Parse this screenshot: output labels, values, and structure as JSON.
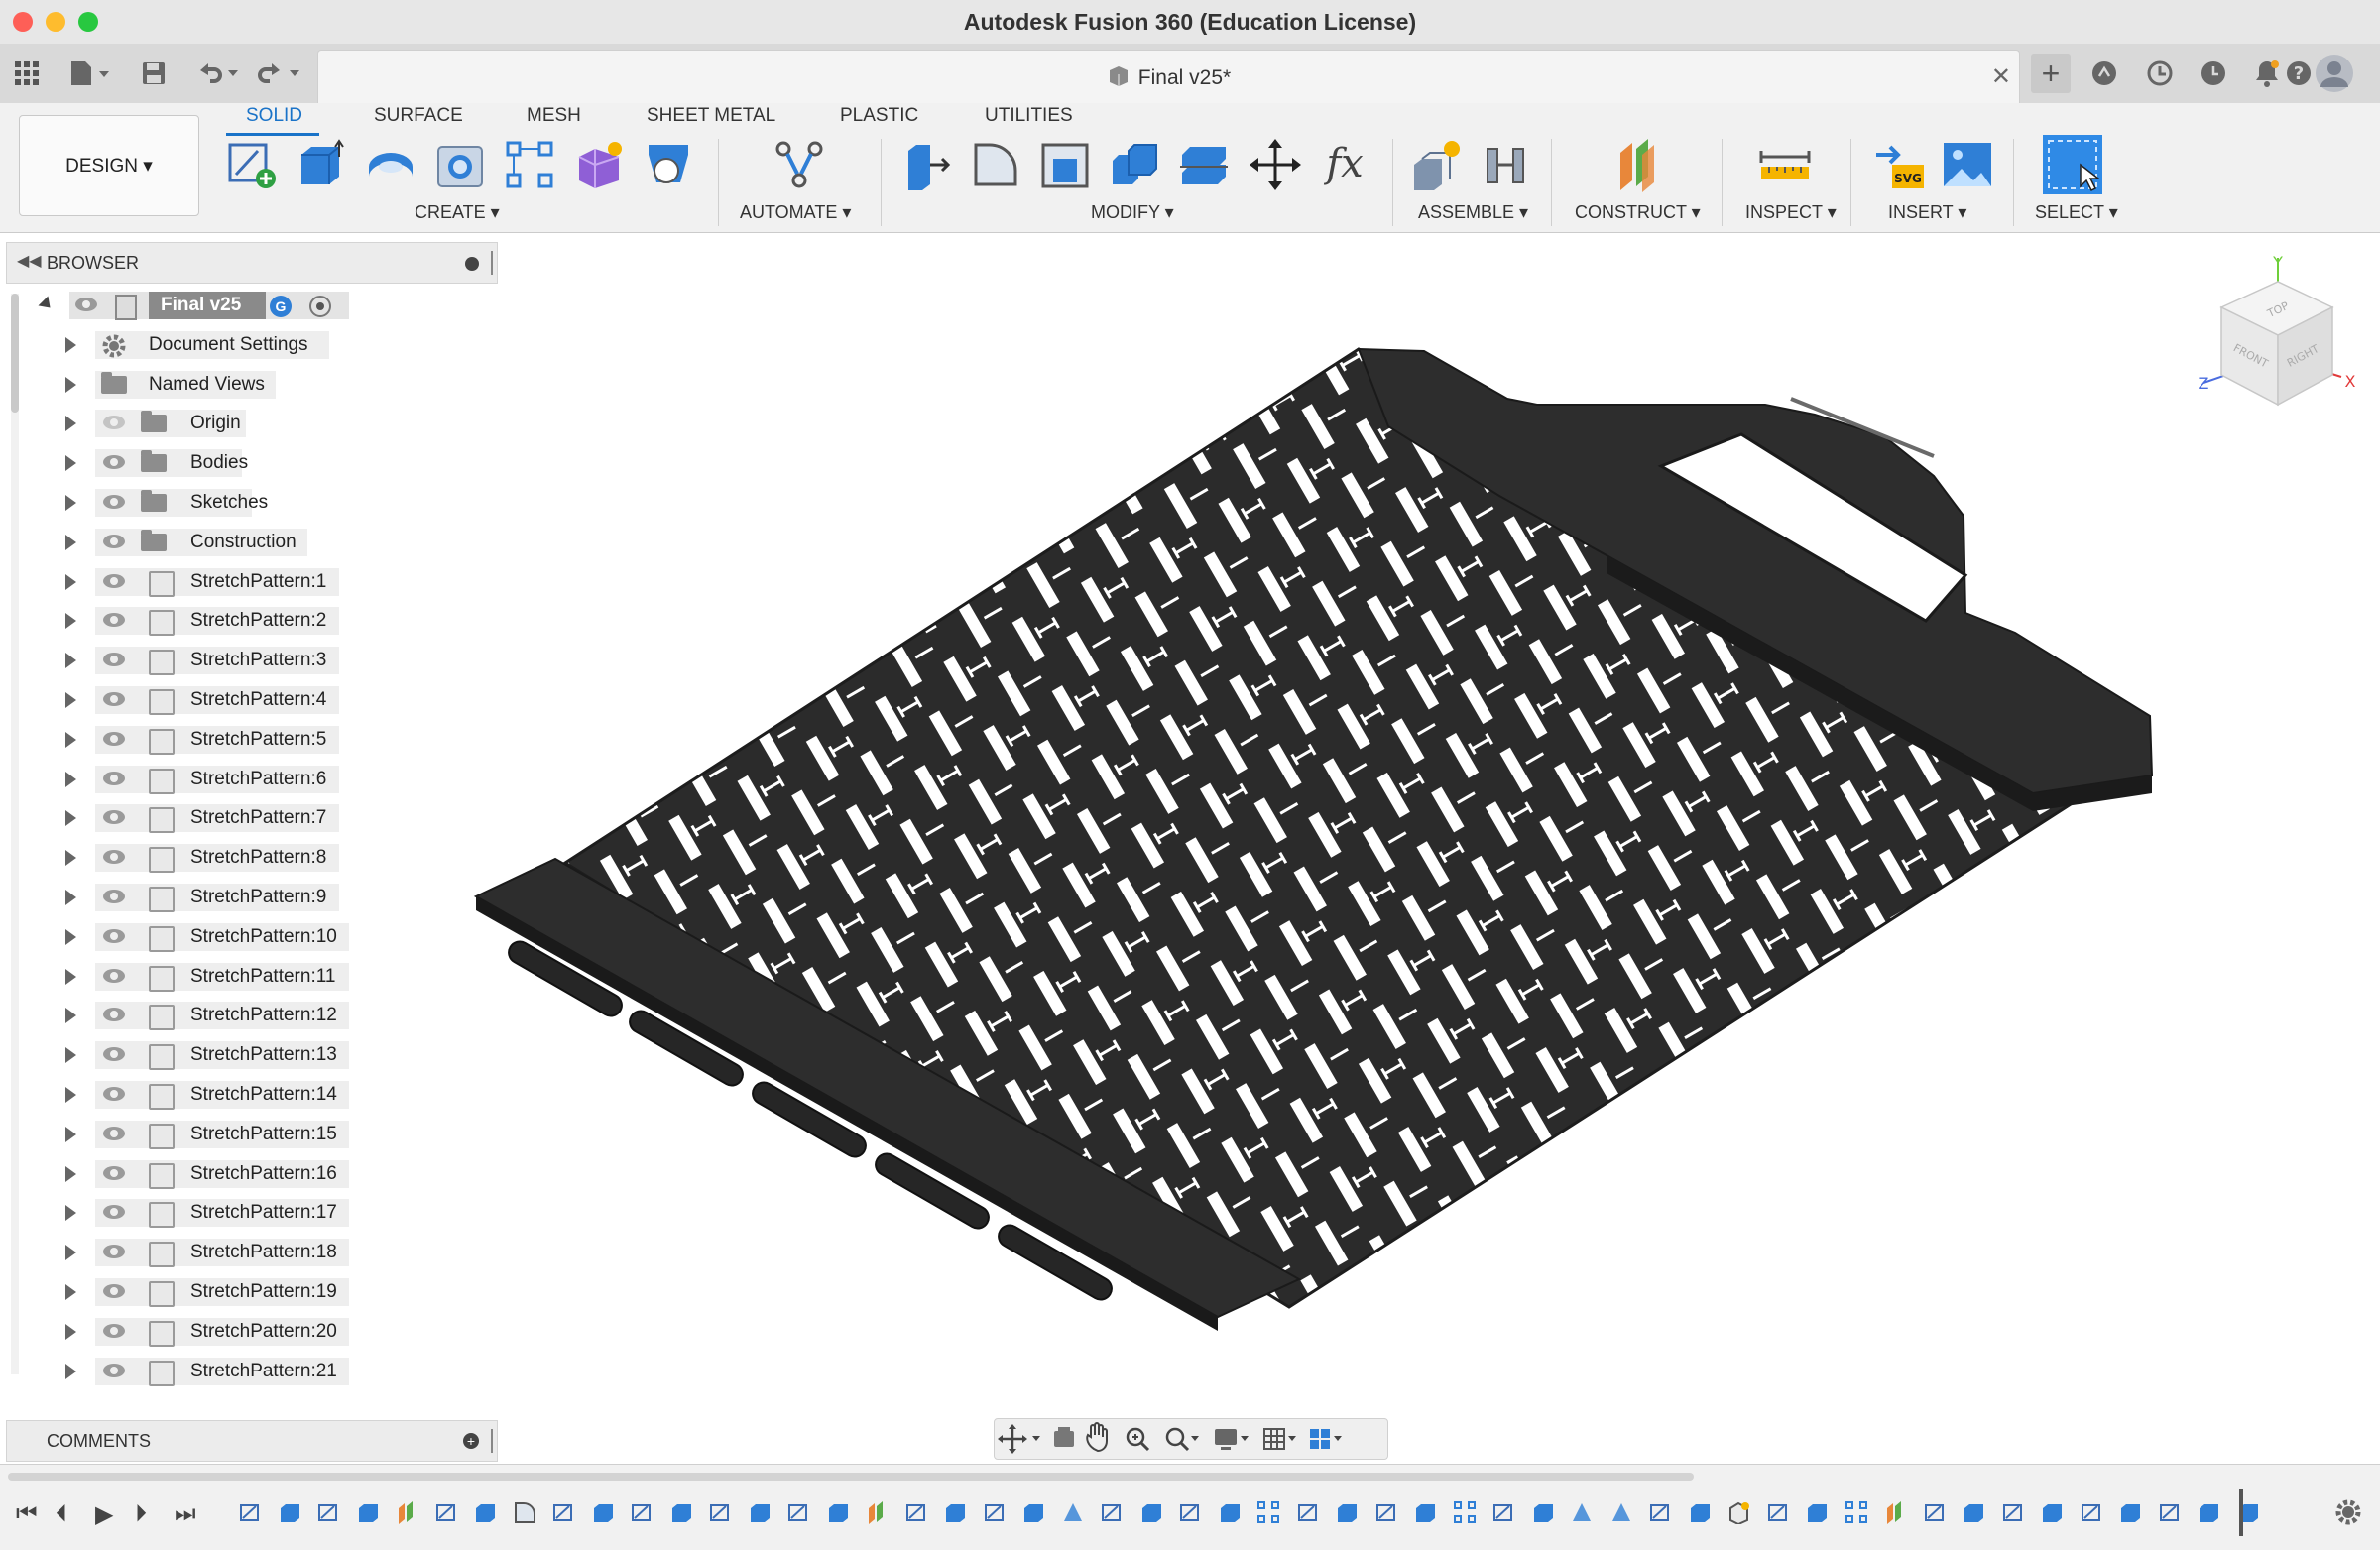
{
  "window": {
    "title": "Autodesk Fusion 360 (Education License)"
  },
  "document_tab": {
    "title": "Final v25*"
  },
  "workspace": {
    "label": "DESIGN ▾"
  },
  "ribbon_tabs": [
    "SOLID",
    "SURFACE",
    "MESH",
    "SHEET METAL",
    "PLASTIC",
    "UTILITIES"
  ],
  "ribbon_groups": [
    "CREATE ▾",
    "AUTOMATE ▾",
    "MODIFY ▾",
    "ASSEMBLE ▾",
    "CONSTRUCT ▾",
    "INSPECT ▾",
    "INSERT ▾",
    "SELECT ▾"
  ],
  "browser": {
    "title": "BROWSER",
    "root": "Final v25",
    "items": [
      "Document Settings",
      "Named Views",
      "Origin",
      "Bodies",
      "Sketches",
      "Construction",
      "StretchPattern:1",
      "StretchPattern:2",
      "StretchPattern:3",
      "StretchPattern:4",
      "StretchPattern:5",
      "StretchPattern:6",
      "StretchPattern:7",
      "StretchPattern:8",
      "StretchPattern:9",
      "StretchPattern:10",
      "StretchPattern:11",
      "StretchPattern:12",
      "StretchPattern:13",
      "StretchPattern:14",
      "StretchPattern:15",
      "StretchPattern:16",
      "StretchPattern:17",
      "StretchPattern:18",
      "StretchPattern:19",
      "StretchPattern:20",
      "StretchPattern:21"
    ]
  },
  "comments": {
    "title": "COMMENTS"
  },
  "viewcube": {
    "top": "TOP",
    "front": "FRONT",
    "right": "RIGHT",
    "axis_x": "X",
    "axis_y": "Y",
    "axis_z": "Z"
  },
  "toolbar_fx": "fx",
  "colors": {
    "accent": "#1a73c8",
    "model": "#2a2a2a"
  }
}
